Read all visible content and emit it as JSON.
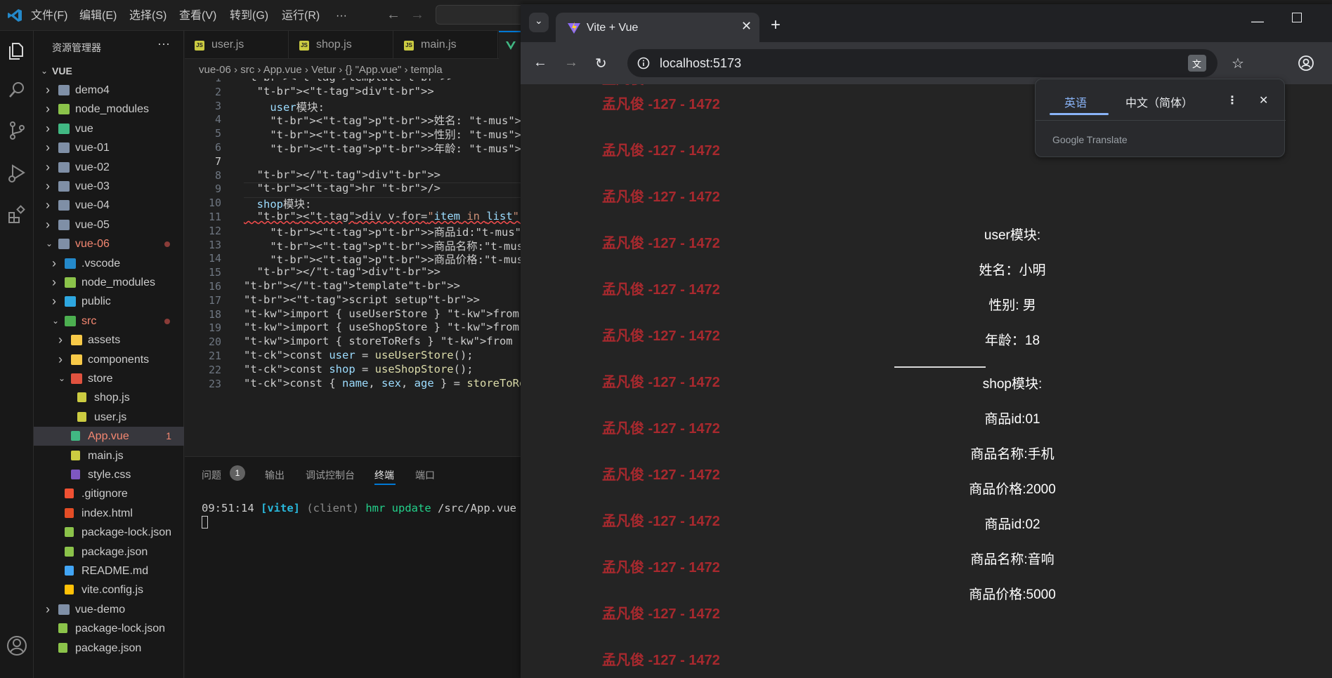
{
  "vscode": {
    "menu": [
      "文件(F)",
      "编辑(E)",
      "选择(S)",
      "查看(V)",
      "转到(G)",
      "运行(R)",
      "···"
    ],
    "sidebar": {
      "title": "资源管理器",
      "more": "···",
      "root": "VUE",
      "items": [
        {
          "label": "demo4",
          "kind": "folder",
          "depth": 1
        },
        {
          "label": "node_modules",
          "kind": "folder-green",
          "depth": 1
        },
        {
          "label": "vue",
          "kind": "folder-vue",
          "depth": 1
        },
        {
          "label": "vue-01",
          "kind": "folder",
          "depth": 1
        },
        {
          "label": "vue-02",
          "kind": "folder",
          "depth": 1
        },
        {
          "label": "vue-03",
          "kind": "folder",
          "depth": 1
        },
        {
          "label": "vue-04",
          "kind": "folder",
          "depth": 1
        },
        {
          "label": "vue-05",
          "kind": "folder",
          "depth": 1
        },
        {
          "label": "vue-06",
          "kind": "folder-open",
          "depth": 1
        },
        {
          "label": ".vscode",
          "kind": "folder-vscode",
          "depth": 2
        },
        {
          "label": "node_modules",
          "kind": "folder-green",
          "depth": 2
        },
        {
          "label": "public",
          "kind": "folder-public",
          "depth": 2
        },
        {
          "label": "src",
          "kind": "folder-src",
          "depth": 2
        },
        {
          "label": "assets",
          "kind": "folder-yellow",
          "depth": 3
        },
        {
          "label": "components",
          "kind": "folder-yellow",
          "depth": 3
        },
        {
          "label": "store",
          "kind": "folder-red",
          "depth": 3
        },
        {
          "label": "shop.js",
          "kind": "js",
          "depth": 4
        },
        {
          "label": "user.js",
          "kind": "js",
          "depth": 4
        },
        {
          "label": "App.vue",
          "kind": "vue",
          "depth": 3
        },
        {
          "label": "main.js",
          "kind": "js",
          "depth": 3
        },
        {
          "label": "style.css",
          "kind": "css",
          "depth": 3
        },
        {
          "label": ".gitignore",
          "kind": "git",
          "depth": 2
        },
        {
          "label": "index.html",
          "kind": "html",
          "depth": 2
        },
        {
          "label": "package-lock.json",
          "kind": "json",
          "depth": 2
        },
        {
          "label": "package.json",
          "kind": "json",
          "depth": 2
        },
        {
          "label": "README.md",
          "kind": "info",
          "depth": 2
        },
        {
          "label": "vite.config.js",
          "kind": "bolt",
          "depth": 2
        },
        {
          "label": "vue-demo",
          "kind": "folder",
          "depth": 1
        },
        {
          "label": "package-lock.json",
          "kind": "json",
          "depth": 1
        },
        {
          "label": "package.json",
          "kind": "json",
          "depth": 1
        }
      ],
      "app_vue_badge": "1"
    },
    "tabs": [
      {
        "label": "user.js"
      },
      {
        "label": "shop.js"
      },
      {
        "label": "main.js"
      }
    ],
    "breadcrumb": "vue-06 › src › App.vue › Vetur › {} \"App.vue\" › templa",
    "line_numbers": [
      "1",
      "2",
      "3",
      "4",
      "5",
      "6",
      "7",
      "8",
      "9",
      "10",
      "11",
      "12",
      "13",
      "14",
      "15",
      "16",
      "17",
      "18",
      "19",
      "20",
      "21",
      "22",
      "23"
    ],
    "code_lines": [
      "<template>",
      "  <div>",
      "    user模块:",
      "    <p>姓名: {{ name }}</p>",
      "    <p>性别: {{ sex }}</p>",
      "    <p>年龄: {{ age }}</p>",
      "",
      "  </div>",
      "  <hr />",
      "  shop模块:",
      "  <div v-for=\"item in list\">",
      "    <p>商品id:{{ item.id }}</p>",
      "    <p>商品名称:{{ item.name }}</p>",
      "    <p>商品价格:{{ item.price }}</p>",
      "  </div>",
      "</template>",
      "<script setup>",
      "import { useUserStore } from \"./store/use",
      "import { useShopStore } from \"./store/sho",
      "import { storeToRefs } from \"pinia\";",
      "const user = useUserStore();",
      "const shop = useShopStore();",
      "const { name, sex, age } = storeToRefs(us"
    ],
    "panel": {
      "tabs": [
        "问题",
        "输出",
        "调试控制台",
        "终端",
        "端口"
      ],
      "problems_count": "1",
      "terminal": {
        "time": "09:51:14",
        "tag": "[vite]",
        "client": "(client)",
        "msg": "hmr update",
        "path": "/src/App.vue (x"
      }
    }
  },
  "browser": {
    "tab_title": "Vite + Vue",
    "url": "localhost:5173",
    "watermark": "孟凡俊 -127 - 1472",
    "translate": {
      "lang_from": "英语",
      "lang_to": "中文（简体）",
      "brand": "Google Translate"
    },
    "page": {
      "user_title": "user模块:",
      "name": "姓名：小明",
      "sex": "性别: 男",
      "age": "年龄：18",
      "shop_title": "shop模块:",
      "item1_id": "商品id:01",
      "item1_name": "商品名称:手机",
      "item1_price": "商品价格:2000",
      "item2_id": "商品id:02",
      "item2_name": "商品名称:音响",
      "item2_price": "商品价格:5000"
    }
  },
  "colors": {
    "accent": "#0078d4",
    "watermark": "#a8292e",
    "vue_green": "#41b883"
  }
}
